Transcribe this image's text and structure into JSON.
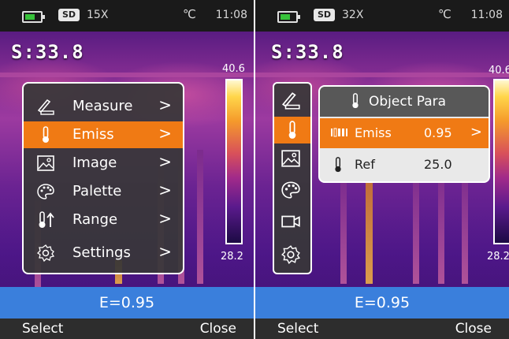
{
  "screen_a": {
    "status": {
      "sd": "SD",
      "zoom": "15X",
      "unit": "℃",
      "time": "11:08"
    },
    "spot": "S:33.8",
    "scale": {
      "max": "40.6",
      "min": "28.2"
    },
    "menu": [
      {
        "label": "Measure",
        "icon": "ruler-pencil-icon",
        "chevron": ">"
      },
      {
        "label": "Emiss",
        "icon": "thermometer-icon",
        "chevron": ">"
      },
      {
        "label": "Image",
        "icon": "image-icon",
        "chevron": ">"
      },
      {
        "label": "Palette",
        "icon": "palette-icon",
        "chevron": ">"
      },
      {
        "label": "Range",
        "icon": "thermometer-up-icon",
        "chevron": ">"
      },
      {
        "label": "Settings",
        "icon": "gear-icon",
        "chevron": ">"
      }
    ],
    "emissivity": "E=0.95",
    "softkeys": {
      "left": "Select",
      "right": "Close"
    }
  },
  "screen_b": {
    "status": {
      "sd": "SD",
      "zoom": "32X",
      "unit": "℃",
      "time": "11:08"
    },
    "spot": "S:33.8",
    "scale": {
      "max": "40.6",
      "min": "28.2"
    },
    "submenu": {
      "title": "Object Para",
      "rows": [
        {
          "label": "Emiss",
          "value": "0.95",
          "chevron": ">"
        },
        {
          "label": "Ref",
          "value": "25.0"
        }
      ]
    },
    "emissivity": "E=0.95",
    "softkeys": {
      "left": "Select",
      "right": "Close"
    }
  },
  "colors": {
    "accent": "#f07a14",
    "ebar": "#3a7fdc",
    "battery": "#37c33a"
  }
}
